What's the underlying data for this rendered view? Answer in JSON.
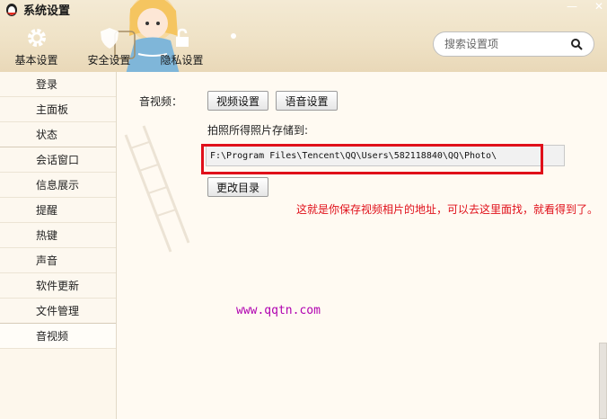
{
  "window": {
    "title": "系统设置",
    "minimize": "—",
    "close": "✕"
  },
  "top_tabs": [
    {
      "label": "基本设置",
      "icon": "gear-icon"
    },
    {
      "label": "安全设置",
      "icon": "shield-icon"
    },
    {
      "label": "隐私设置",
      "icon": "lock-icon"
    }
  ],
  "search": {
    "placeholder": "搜索设置项",
    "icon": "search-icon"
  },
  "sidebar": {
    "items": [
      {
        "label": "登录"
      },
      {
        "label": "主面板"
      },
      {
        "label": "状态"
      },
      {
        "label": "会话窗口"
      },
      {
        "label": "信息展示"
      },
      {
        "label": "提醒"
      },
      {
        "label": "热键"
      },
      {
        "label": "声音"
      },
      {
        "label": "软件更新"
      },
      {
        "label": "文件管理"
      },
      {
        "label": "音视频"
      }
    ],
    "active": "音视频"
  },
  "main": {
    "section_label": "音视频：",
    "video_settings": "视频设置",
    "audio_settings": "语音设置",
    "photo_path_label": "拍照所得照片存储到:",
    "photo_path_value": "F:\\Program Files\\Tencent\\QQ\\Users\\582118840\\QQ\\Photo\\",
    "change_dir": "更改目录",
    "annotation": "这就是你保存视频相片的地址，可以去这里面找，就看得到了。",
    "watermark": "www.qqtn.com"
  },
  "colors": {
    "annotation": "#e0101a",
    "highlight": "#e0101a",
    "watermark": "#b000b0"
  }
}
